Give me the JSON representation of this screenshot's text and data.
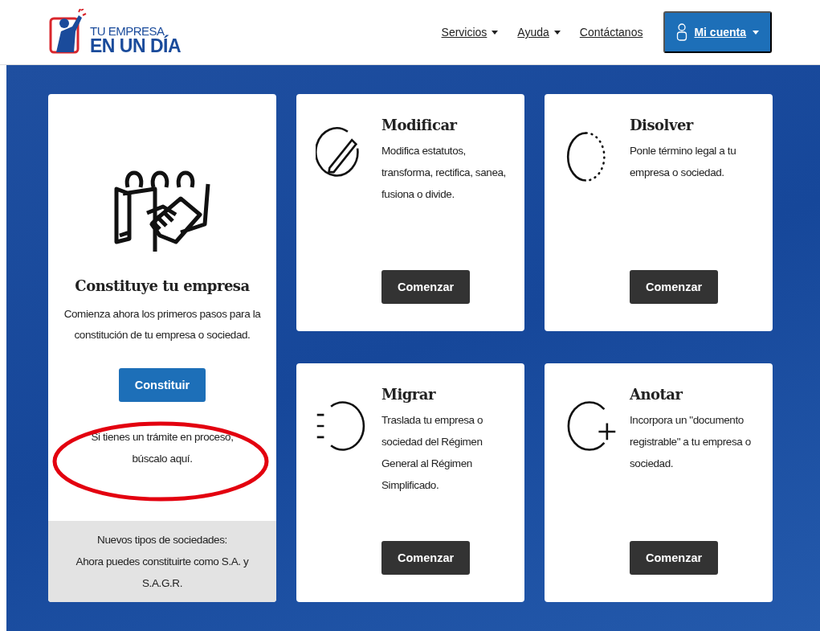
{
  "header": {
    "logo": {
      "line_1": "TU EMPRESA",
      "line_2": "EN UN DÍA"
    },
    "nav": [
      {
        "label": "Servicios",
        "dropdown": true
      },
      {
        "label": "Ayuda",
        "dropdown": true
      },
      {
        "label": "Contáctanos",
        "dropdown": false
      }
    ],
    "account": {
      "label": "Mi cuenta",
      "dropdown": true
    }
  },
  "main_card": {
    "title": "Constituye tu empresa",
    "text": "Comienza ahora los primeros pasos para la constitución de tu empresa o sociedad.",
    "button": "Constituir",
    "note": "Si tienes un trámite en proceso,",
    "link": "búscalo aquí",
    "note_end": ".",
    "footer": [
      "Nuevos tipos de sociedades:",
      "Ahora puedes constituirte como S.A. y S.A.G.R."
    ]
  },
  "cards": [
    {
      "kind": "modify",
      "title": "Modificar",
      "text": "Modifica estatutos, transforma, rectifica, sanea, fusiona o divide.",
      "button": "Comenzar"
    },
    {
      "kind": "dissolve",
      "title": "Disolver",
      "text": "Ponle término legal a tu empresa o sociedad.",
      "button": "Comenzar"
    },
    {
      "kind": "migrate",
      "title": "Migrar",
      "text": "Traslada tu empresa o sociedad del Régimen General al Régimen Simplificado.",
      "button": "Comenzar"
    },
    {
      "kind": "annotate",
      "title": "Anotar",
      "text": "Incorpora un \"documento registrable\" a tu empresa o sociedad.",
      "button": "Comenzar"
    }
  ]
}
